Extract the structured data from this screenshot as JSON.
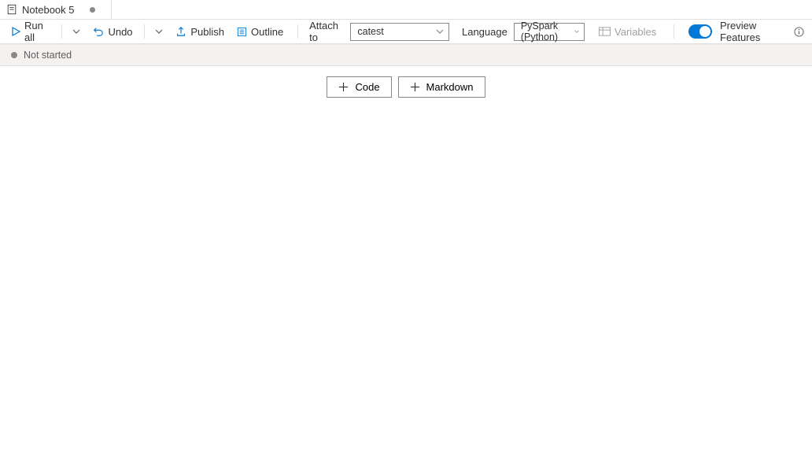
{
  "tab": {
    "title": "Notebook 5"
  },
  "toolbar": {
    "run_all": "Run all",
    "undo": "Undo",
    "publish": "Publish",
    "outline": "Outline",
    "attach_label": "Attach to",
    "attach_value": "catest",
    "language_label": "Language",
    "language_value": "PySpark (Python)",
    "variables": "Variables",
    "preview": "Preview Features"
  },
  "status": {
    "text": "Not started"
  },
  "cells": {
    "code": "Code",
    "markdown": "Markdown"
  }
}
